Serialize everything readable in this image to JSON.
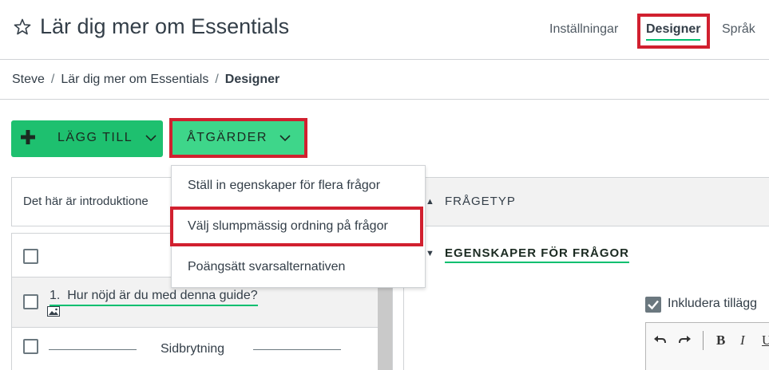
{
  "header": {
    "title": "Lär dig mer om Essentials",
    "nav": {
      "settings": "Inställningar",
      "designer": "Designer",
      "language": "Språk"
    }
  },
  "breadcrumb": {
    "items": [
      "Steve",
      "Lär dig mer om Essentials",
      "Designer"
    ]
  },
  "toolbar": {
    "add_label": "LÄGG TILL",
    "actions_label": "ÅTGÄRDER"
  },
  "actions_menu": {
    "items": [
      "Ställ in egenskaper för flera frågor",
      "Välj slumpmässig ordning på frågor",
      "Poängsätt svarsalternativen"
    ]
  },
  "intro": {
    "text": "Det här är introduktione"
  },
  "questions": {
    "q1_number": "1.",
    "q1_text": "Hur nöjd är du med denna guide?",
    "page_break_label": "Sidbrytning"
  },
  "right_panel": {
    "question_type_label": "FRÅGETYP",
    "question_props_label": "EGENSKAPER FÖR FRÅGOR",
    "include_label": "Inkludera tillägg"
  },
  "colors": {
    "accent_green": "#00bf6f",
    "add_button": "#1ec06f",
    "actions_button": "#3ed68a",
    "highlight_red": "#d1202f"
  },
  "icons": [
    "star-icon",
    "plus-icon",
    "chevron-down-icon",
    "image-icon",
    "triangle-right-icon",
    "triangle-down-icon",
    "checkmark-icon",
    "undo-icon",
    "redo-icon"
  ]
}
